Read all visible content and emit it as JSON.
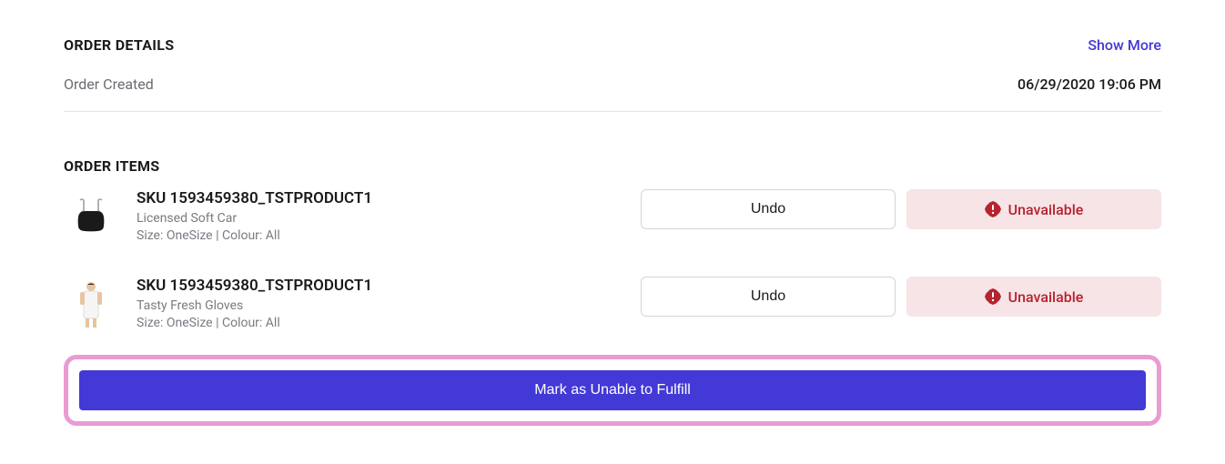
{
  "order_details": {
    "title": "ORDER DETAILS",
    "show_more_label": "Show More",
    "created_label": "Order Created",
    "created_value": "06/29/2020 19:06 PM"
  },
  "order_items": {
    "title": "ORDER ITEMS",
    "items": [
      {
        "sku": "SKU 1593459380_TSTPRODUCT1",
        "name": "Licensed Soft Car",
        "variant": "Size: OneSize | Colour: All",
        "undo_label": "Undo",
        "status_label": "Unavailable"
      },
      {
        "sku": "SKU 1593459380_TSTPRODUCT1",
        "name": "Tasty Fresh Gloves",
        "variant": "Size: OneSize | Colour: All",
        "undo_label": "Undo",
        "status_label": "Unavailable"
      }
    ]
  },
  "actions": {
    "mark_unable_label": "Mark as Unable to Fulfill"
  },
  "colors": {
    "primary": "#4339d6",
    "error": "#b4232f",
    "error_bg": "#f6e4e6",
    "highlight_border": "#e99bd3"
  }
}
